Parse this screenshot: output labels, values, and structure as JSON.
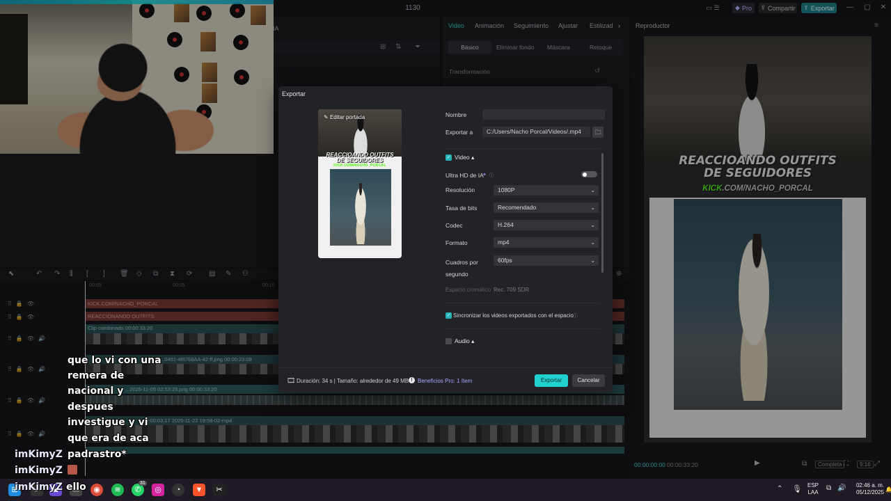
{
  "app": {
    "title": "1130",
    "pro_label": "Pro",
    "share_label": "Compartir",
    "export_label": "Exportar",
    "accent_color": "#20d1d0"
  },
  "left_panel": {
    "header": "IA"
  },
  "inspector": {
    "tabs": [
      "Video",
      "Animación",
      "Seguimiento",
      "Ajustar",
      "Estilizad"
    ],
    "subtabs": [
      "Básico",
      "Eliminar fondo",
      "Máscara",
      "Retoque"
    ],
    "section": "Transformación"
  },
  "player": {
    "title": "Reproductor",
    "headline_line1": "REACCIOANDO OUTFITS",
    "headline_line2": "DE SEGUIDORES",
    "handle_kick": "KICK",
    "handle_rest": ".COM/NACHO_PORCAL",
    "time_current": "00:00:00:00",
    "time_total": "00:00:33:20",
    "complete_label": "Completa",
    "ratio_label": "9:16"
  },
  "timeline": {
    "ruler": [
      "00:00",
      "00:05",
      "00:10"
    ],
    "text_clip_1": "KICK.COM/NACHO_PORCAL",
    "text_clip_2": "REACCIONANDO OUTFITS",
    "main_clip": "Clip combinado  00:00:33:20",
    "clip_png": "...0451-4f6768AA-42:ff,png  00:00:23:08",
    "clip_png2": "...2025-11-05 02:53:25.png  00:00:33:20",
    "bottom_clip": "00:00:03:17   2025-11-22 19:58-02-mp4"
  },
  "export_dialog": {
    "title": "Exportar",
    "edit_cover": "Editar portada",
    "cover_headline_1": "REACCIOANDO OUTFITS",
    "cover_headline_2": "DE SEGUIDORES",
    "cover_handle": "KICK.COM/NACHO_PORCAL",
    "name_label": "Nombre",
    "name_value": "",
    "export_to_label": "Exportar a",
    "export_to_value": "C:/Users/Nacho Porcal/Videos/.mp4",
    "video_section": "Video",
    "uhd_label": "Ultra HD de IA",
    "resolution_label": "Resolución",
    "resolution_value": "1080P",
    "bitrate_label": "Tasa de bits",
    "bitrate_value": "Recomendado",
    "codec_label": "Codec",
    "codec_value": "H.264",
    "format_label": "Formato",
    "format_value": "mp4",
    "fps_label_1": "Cuadros por",
    "fps_label_2": "segundo",
    "fps_value": "60fps",
    "colorspace_label": "Espacio cromático",
    "colorspace_value": "Rec. 709 SDR",
    "sync_label": "Sincronizar los videos exportados con el espacio",
    "audio_section": "Audio",
    "duration_text": "Duración: 34 s | Tamaño: alrededor de 49 MB",
    "pro_benefits": "Beneficios Pro: 1 ítem",
    "export_button": "Exportar",
    "cancel_button": "Cancelar"
  },
  "chat": {
    "lines": [
      "que lo vi con una",
      "remera de",
      "nacional y",
      "despues",
      "investigue y vi",
      "que era de aca",
      "padrastro*"
    ],
    "user_1": "imKimyZ",
    "user_2": "imKimyZ",
    "user_3": "imKimyZ",
    "overlap_text": "ello"
  },
  "taskbar": {
    "lang_1": "ESP",
    "lang_2": "LAA",
    "time": "02:46 a. m.",
    "date": "05/12/2025",
    "whatsapp_badge": "31"
  }
}
